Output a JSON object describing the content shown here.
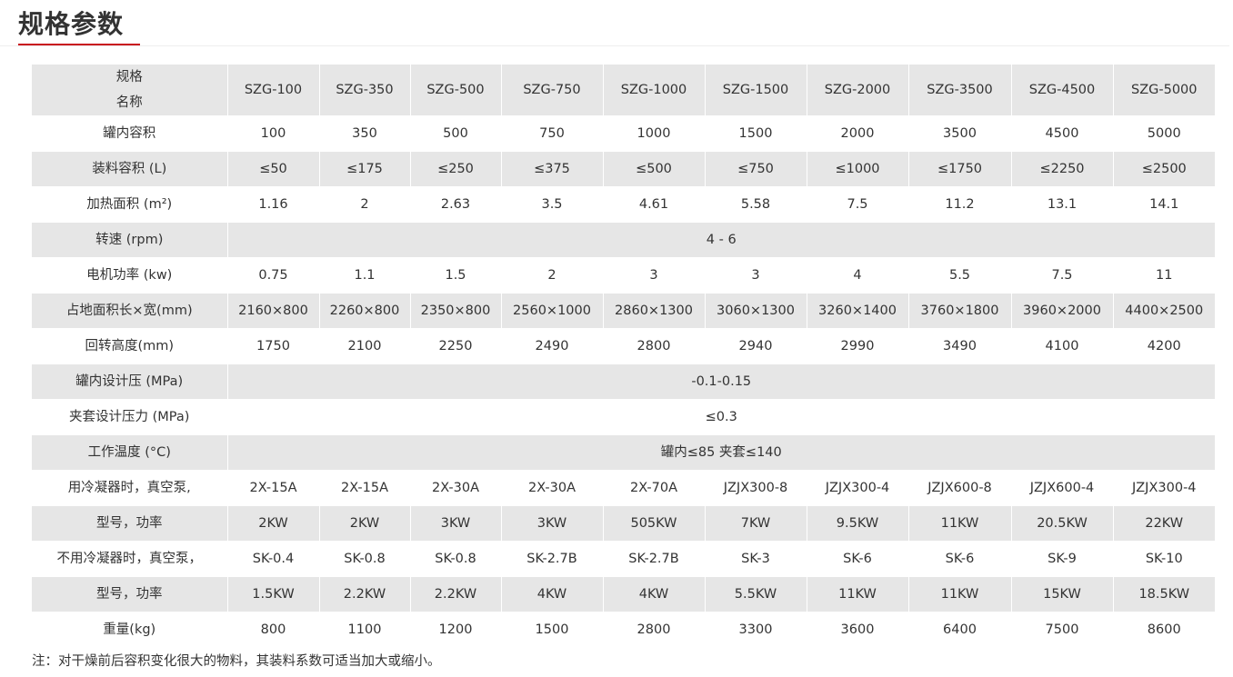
{
  "section_title": "规格参数",
  "accent_color": "#c8101e",
  "header": {
    "label_line1": "规格",
    "label_line2": "名称",
    "models": [
      "SZG-100",
      "SZG-350",
      "SZG-500",
      "SZG-750",
      "SZG-1000",
      "SZG-1500",
      "SZG-2000",
      "SZG-3500",
      "SZG-4500",
      "SZG-5000"
    ]
  },
  "rows": [
    {
      "label": "罐内容积",
      "values": [
        "100",
        "350",
        "500",
        "750",
        "1000",
        "1500",
        "2000",
        "3500",
        "4500",
        "5000"
      ]
    },
    {
      "label": "装料容积 (L)",
      "values": [
        "≤50",
        "≤175",
        "≤250",
        "≤375",
        "≤500",
        "≤750",
        "≤1000",
        "≤1750",
        "≤2250",
        "≤2500"
      ]
    },
    {
      "label": "加热面积 (m²)",
      "values": [
        "1.16",
        "2",
        "2.63",
        "3.5",
        "4.61",
        "5.58",
        "7.5",
        "11.2",
        "13.1",
        "14.1"
      ]
    },
    {
      "label": "转速 (rpm)",
      "merged": "4 - 6"
    },
    {
      "label": "电机功率 (kw)",
      "values": [
        "0.75",
        "1.1",
        "1.5",
        "2",
        "3",
        "3",
        "4",
        "5.5",
        "7.5",
        "11"
      ]
    },
    {
      "label": "占地面积长×宽(mm)",
      "values": [
        "2160×800",
        "2260×800",
        "2350×800",
        "2560×1000",
        "2860×1300",
        "3060×1300",
        "3260×1400",
        "3760×1800",
        "3960×2000",
        "4400×2500"
      ]
    },
    {
      "label": "回转高度(mm)",
      "values": [
        "1750",
        "2100",
        "2250",
        "2490",
        "2800",
        "2940",
        "2990",
        "3490",
        "4100",
        "4200"
      ]
    },
    {
      "label": "罐内设计压 (MPa)",
      "merged": "-0.1-0.15"
    },
    {
      "label": "夹套设计压力 (MPa)",
      "merged": "≤0.3"
    },
    {
      "label": "工作温度 (°C)",
      "merged": "罐内≤85 夹套≤140"
    },
    {
      "label": "用冷凝器时，真空泵,",
      "values": [
        "2X-15A",
        "2X-15A",
        "2X-30A",
        "2X-30A",
        "2X-70A",
        "JZJX300-8",
        "JZJX300-4",
        "JZJX600-8",
        "JZJX600-4",
        "JZJX300-4"
      ]
    },
    {
      "label": "型号，功率",
      "values": [
        "2KW",
        "2KW",
        "3KW",
        "3KW",
        "505KW",
        "7KW",
        "9.5KW",
        "11KW",
        "20.5KW",
        "22KW"
      ]
    },
    {
      "label": "不用冷凝器时，真空泵，",
      "values": [
        "SK-0.4",
        "SK-0.8",
        "SK-0.8",
        "SK-2.7B",
        "SK-2.7B",
        "SK-3",
        "SK-6",
        "SK-6",
        "SK-9",
        "SK-10"
      ]
    },
    {
      "label": "型号，功率",
      "values": [
        "1.5KW",
        "2.2KW",
        "2.2KW",
        "4KW",
        "4KW",
        "5.5KW",
        "11KW",
        "11KW",
        "15KW",
        "18.5KW"
      ]
    },
    {
      "label": "重量(kg)",
      "values": [
        "800",
        "1100",
        "1200",
        "1500",
        "2800",
        "3300",
        "3600",
        "6400",
        "7500",
        "8600"
      ]
    }
  ],
  "note": "注：对干燥前后容积变化很大的物料，其装料系数可适当加大或缩小。"
}
